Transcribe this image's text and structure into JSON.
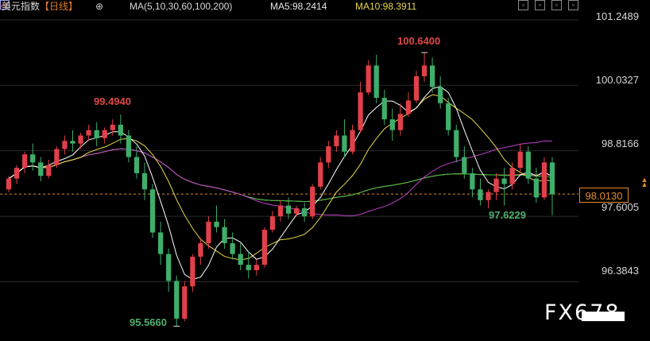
{
  "toolbar": {
    "title": "美元指数",
    "period": "【日线】",
    "ma_params": "MA(5,10,30,60,100,200)",
    "ma5": "MA5:98.2414",
    "ma10": "MA10:98.3911",
    "icons": [
      "settings-icon",
      "indicator-icon",
      "window-icon-1",
      "window-icon-2",
      "window-icon-3",
      "window-icon-4"
    ]
  },
  "y_axis": {
    "labels": [
      "101.2489",
      "100.0327",
      "98.8166",
      "97.6005",
      "96.3843"
    ]
  },
  "current_price": "98.0130",
  "annotations": {
    "high1": "100.6400",
    "high2": "99.4940",
    "low1": "97.6229",
    "low2": "95.5660"
  },
  "watermark": "FX678",
  "colors": {
    "up": "#e0404a",
    "down": "#3fae6a",
    "ma5": "#ffffff",
    "ma10": "#e8d84a",
    "ma30": "#c040c8",
    "ma60": "#3cc83c",
    "ma100": "#e04848",
    "ma200": "#a0a0a0",
    "current": "#e08a2a"
  },
  "chart_data": {
    "type": "candlestick",
    "ylim": [
      95.3,
      101.35
    ],
    "y_ticks": [
      101.2489,
      100.0327,
      98.8166,
      97.6005,
      96.3843
    ],
    "current_price": 98.013,
    "candles": [
      [
        98.1,
        98.35,
        98.3,
        98.05
      ],
      [
        98.3,
        98.55,
        98.5,
        98.2
      ],
      [
        98.5,
        98.8,
        98.75,
        98.4
      ],
      [
        98.75,
        98.95,
        98.6,
        98.45
      ],
      [
        98.6,
        98.7,
        98.35,
        98.25
      ],
      [
        98.35,
        98.65,
        98.55,
        98.3
      ],
      [
        98.55,
        98.9,
        98.85,
        98.5
      ],
      [
        98.85,
        99.1,
        99.0,
        98.75
      ],
      [
        99.0,
        99.2,
        98.95,
        98.8
      ],
      [
        98.95,
        99.15,
        99.1,
        98.85
      ],
      [
        99.1,
        99.3,
        99.2,
        99.0
      ],
      [
        99.2,
        99.35,
        99.05,
        98.9
      ],
      [
        99.05,
        99.25,
        99.2,
        98.95
      ],
      [
        99.2,
        99.4,
        99.3,
        99.1
      ],
      [
        99.3,
        99.49,
        99.1,
        98.95
      ],
      [
        99.1,
        99.2,
        98.7,
        98.6
      ],
      [
        98.7,
        98.9,
        98.4,
        98.3
      ],
      [
        98.4,
        98.6,
        98.1,
        97.9
      ],
      [
        98.1,
        98.2,
        97.3,
        97.2
      ],
      [
        97.3,
        97.5,
        96.9,
        96.7
      ],
      [
        96.9,
        97.0,
        96.4,
        96.2
      ],
      [
        96.4,
        96.5,
        95.7,
        95.56
      ],
      [
        95.7,
        96.4,
        96.3,
        95.65
      ],
      [
        96.3,
        96.9,
        96.85,
        96.2
      ],
      [
        96.85,
        97.2,
        97.1,
        96.7
      ],
      [
        97.1,
        97.6,
        97.5,
        97.0
      ],
      [
        97.5,
        97.8,
        97.4,
        97.3
      ],
      [
        97.4,
        97.55,
        97.1,
        97.0
      ],
      [
        97.1,
        97.3,
        96.9,
        96.8
      ],
      [
        96.9,
        97.1,
        96.7,
        96.6
      ],
      [
        96.7,
        96.95,
        96.6,
        96.45
      ],
      [
        96.6,
        96.8,
        96.7,
        96.5
      ],
      [
        96.7,
        97.4,
        97.35,
        96.65
      ],
      [
        97.35,
        97.7,
        97.6,
        97.3
      ],
      [
        97.6,
        97.9,
        97.8,
        97.5
      ],
      [
        97.8,
        97.95,
        97.65,
        97.55
      ],
      [
        97.65,
        97.8,
        97.75,
        97.6
      ],
      [
        97.75,
        97.85,
        97.6,
        97.5
      ],
      [
        97.6,
        98.2,
        98.15,
        97.55
      ],
      [
        98.15,
        98.7,
        98.6,
        98.1
      ],
      [
        98.6,
        99.0,
        98.9,
        98.5
      ],
      [
        98.9,
        99.2,
        99.1,
        98.8
      ],
      [
        99.1,
        99.4,
        98.8,
        98.7
      ],
      [
        98.8,
        99.3,
        99.2,
        98.75
      ],
      [
        99.2,
        100.1,
        99.9,
        99.15
      ],
      [
        99.9,
        100.5,
        100.4,
        99.85
      ],
      [
        100.4,
        100.6,
        99.8,
        99.7
      ],
      [
        99.8,
        99.95,
        99.4,
        99.3
      ],
      [
        99.4,
        99.6,
        99.2,
        99.0
      ],
      [
        99.2,
        99.7,
        99.5,
        99.1
      ],
      [
        99.5,
        99.9,
        99.75,
        99.45
      ],
      [
        99.75,
        100.3,
        100.2,
        99.7
      ],
      [
        100.2,
        100.64,
        100.4,
        100.1
      ],
      [
        100.4,
        100.55,
        100.0,
        99.9
      ],
      [
        100.0,
        100.2,
        99.7,
        99.6
      ],
      [
        99.7,
        99.8,
        99.2,
        99.1
      ],
      [
        99.2,
        99.3,
        98.7,
        98.6
      ],
      [
        98.7,
        98.9,
        98.4,
        98.3
      ],
      [
        98.4,
        98.5,
        98.1,
        97.95
      ],
      [
        98.1,
        98.3,
        97.9,
        97.8
      ],
      [
        97.9,
        98.1,
        98.05,
        97.75
      ],
      [
        98.05,
        98.4,
        98.3,
        97.9
      ],
      [
        98.3,
        98.5,
        98.2,
        97.8
      ],
      [
        98.2,
        98.6,
        98.5,
        98.1
      ],
      [
        98.5,
        98.95,
        98.8,
        98.4
      ],
      [
        98.8,
        98.9,
        98.3,
        98.2
      ],
      [
        98.3,
        98.5,
        97.95,
        97.85
      ],
      [
        97.95,
        98.7,
        98.6,
        97.9
      ],
      [
        98.6,
        98.7,
        98.01,
        97.62
      ]
    ]
  }
}
